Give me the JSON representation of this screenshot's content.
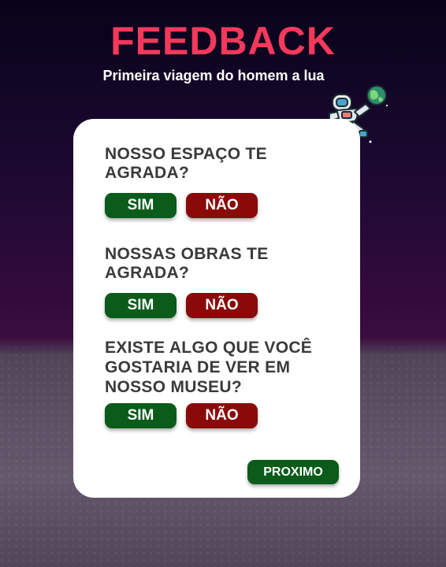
{
  "header": {
    "title": "FEEDBACK",
    "subtitle": "Primeira viagem do homem a lua"
  },
  "questions": [
    {
      "text": "NOSSO ESPAÇO TE AGRADA?",
      "yes_label": "SIM",
      "no_label": "NÃO"
    },
    {
      "text": "NOSSAS OBRAS TE AGRADA?",
      "yes_label": "SIM",
      "no_label": "NÃO"
    },
    {
      "text": "EXISTE ALGO QUE VOCÊ GOSTARIA DE VER EM NOSSO MUSEU?",
      "yes_label": "SIM",
      "no_label": "NÃO"
    }
  ],
  "next_button": {
    "label": "PROXIMO"
  },
  "colors": {
    "title": "#f4395b",
    "yes": "#0b5b1a",
    "no": "#8a0a0a",
    "card": "#ffffff"
  },
  "icons": {
    "illustration": "astronaut-icon"
  }
}
